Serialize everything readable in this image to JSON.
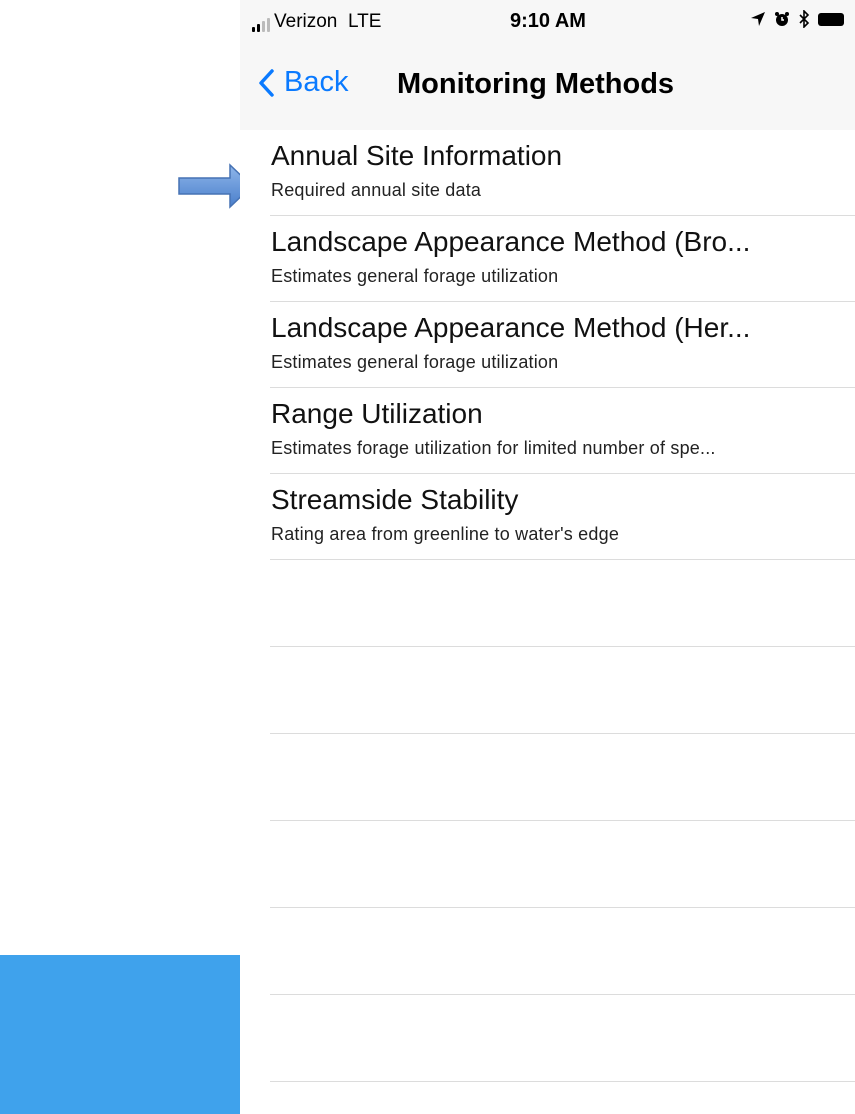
{
  "status_bar": {
    "carrier": "Verizon",
    "network": "LTE",
    "time": "9:10 AM",
    "icons": [
      "location-arrow-icon",
      "alarm-icon",
      "bluetooth-icon",
      "battery-icon"
    ]
  },
  "nav": {
    "back_label": "Back",
    "title": "Monitoring Methods"
  },
  "methods": [
    {
      "title": "Annual Site Information",
      "subtitle": "Required annual site data"
    },
    {
      "title": "Landscape Appearance Method (Bro...",
      "subtitle": "Estimates general forage utilization"
    },
    {
      "title": "Landscape Appearance Method (Her...",
      "subtitle": "Estimates general forage utilization"
    },
    {
      "title": "Range Utilization",
      "subtitle": "Estimates forage utilization for limited number of spe..."
    },
    {
      "title": "Streamside Stability",
      "subtitle": "Rating area from greenline to water's edge"
    }
  ],
  "colors": {
    "accent": "#0a7aff",
    "annotation_arrow": "#5b8fd6",
    "blue_block": "#3fa2ec",
    "bar_background": "#f7f7f7",
    "separator": "#dcdcdc"
  }
}
